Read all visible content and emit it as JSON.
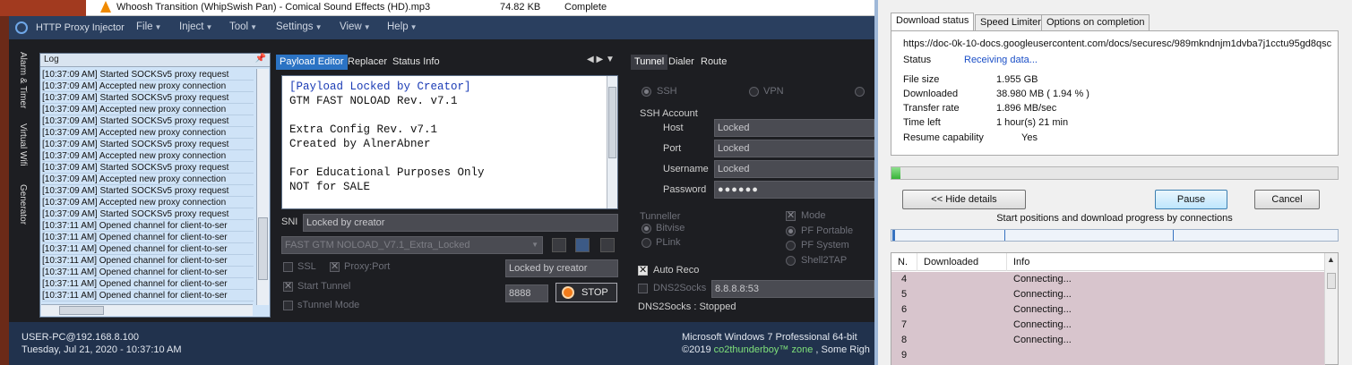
{
  "background_download": {
    "filename": "Whoosh Transition (WhipSwish Pan) - Comical Sound Effects (HD).mp3",
    "size": "74.82  KB",
    "status": "Complete"
  },
  "injector": {
    "title": "HTTP Proxy Injector",
    "menu": [
      "File",
      "Inject",
      "Tool",
      "Settings",
      "View",
      "Help"
    ],
    "side_tabs": [
      "Alarm & Timer",
      "Virtual Wifi",
      "Generator"
    ],
    "log": {
      "title": "Log",
      "lines": [
        "[10:37:09 AM] Started SOCKSv5 proxy request",
        "[10:37:09 AM] Accepted new proxy connection",
        "[10:37:09 AM] Started SOCKSv5 proxy request",
        "[10:37:09 AM] Accepted new proxy connection",
        "[10:37:09 AM] Started SOCKSv5 proxy request",
        "[10:37:09 AM] Accepted new proxy connection",
        "[10:37:09 AM] Started SOCKSv5 proxy request",
        "[10:37:09 AM] Accepted new proxy connection",
        "[10:37:09 AM] Started SOCKSv5 proxy request",
        "[10:37:09 AM] Accepted new proxy connection",
        "[10:37:09 AM] Started SOCKSv5 proxy request",
        "[10:37:09 AM] Accepted new proxy connection",
        "[10:37:09 AM] Started SOCKSv5 proxy request",
        "[10:37:11 AM] Opened channel for client-to-ser",
        "[10:37:11 AM] Opened channel for client-to-ser",
        "[10:37:11 AM] Opened channel for client-to-ser",
        "[10:37:11 AM] Opened channel for client-to-ser",
        "[10:37:11 AM] Opened channel for client-to-ser",
        "[10:37:11 AM] Opened channel for client-to-ser",
        "[10:37:11 AM] Opened channel for client-to-ser"
      ]
    },
    "center_tabs": [
      "Payload Editor",
      "Replacer",
      "Status Info"
    ],
    "payload": {
      "line1": "[Payload Locked by Creator]",
      "body": "\nGTM FAST NOLOAD Rev. v7.1\n\nExtra Config Rev. v7.1\nCreated by AlnerAbner\n\nFor Educational Purposes Only\nNOT for SALE"
    },
    "sni_label": "SNI",
    "sni_value": "Locked by creator",
    "config_select": "FAST GTM NOLOAD_V7.1_Extra_Locked",
    "ssl_label": "SSL",
    "proxy_port_label": "Proxy:Port",
    "proxy_value": "Locked by creator",
    "start_tunnel_label": "Start Tunnel",
    "stunnel_label": "sTunnel Mode",
    "port_value": "8888",
    "stop_label": "STOP",
    "right_tabs": [
      "Tunnel",
      "Dialer",
      "Route"
    ],
    "ssh_label": "SSH",
    "vpn_label": "VPN",
    "ssh_account_label": "SSH Account",
    "host_label": "Host",
    "host_value": "Locked",
    "port_label": "Port",
    "port_field_value": "Locked",
    "username_label": "Username",
    "username_value": "Locked",
    "password_label": "Password",
    "password_value": "●●●●●●",
    "tunneller_label": "Tunneller",
    "bitvise_label": "Bitvise",
    "plink_label": "PLink",
    "mode_label": "Mode",
    "pf_portable_label": "PF Portable",
    "pf_system_label": "PF System",
    "shell2tap_label": "Shell2TAP",
    "auto_reco_label": "Auto Reco",
    "dns2socks_label": "DNS2Socks",
    "dns_value": "8.8.8.8:53",
    "dns2socks_status": "DNS2Socks : Stopped",
    "status_user": "USER-PC@192.168.8.100",
    "status_datetime": "Tuesday, Jul 21, 2020 - 10:37:10 AM",
    "status_os": "Microsoft Windows 7 Professional  64-bit",
    "status_copyright_pre": "©2019 ",
    "status_copyright_brand": "co2thunderboy™ zone",
    "status_copyright_post": " , Some Righ"
  },
  "download_dialog": {
    "tabs": [
      "Download status",
      "Speed Limiter",
      "Options on completion"
    ],
    "url": "https://doc-0k-10-docs.googleusercontent.com/docs/securesc/989mkndnjm1dvba7j1cctu95gd8qsc",
    "status_label": "Status",
    "status_value": "Receiving data...",
    "file_size_label": "File size",
    "file_size_value": "1.955  GB",
    "downloaded_label": "Downloaded",
    "downloaded_value": "38.980  MB  ( 1.94 % )",
    "transfer_rate_label": "Transfer rate",
    "transfer_rate_value": "1.896  MB/sec",
    "time_left_label": "Time left",
    "time_left_value": "1 hour(s) 21 min",
    "resume_label": "Resume capability",
    "resume_value": "Yes",
    "progress_fraction": 0.0194,
    "hide_details_label": "<< Hide details",
    "pause_label": "Pause",
    "cancel_label": "Cancel",
    "connections_caption": "Start positions and download progress by connections",
    "table_headers": [
      "N.",
      "Downloaded",
      "Info"
    ],
    "rows": [
      {
        "n": "4",
        "info": "Connecting..."
      },
      {
        "n": "5",
        "info": "Connecting..."
      },
      {
        "n": "6",
        "info": "Connecting..."
      },
      {
        "n": "7",
        "info": "Connecting..."
      },
      {
        "n": "8",
        "info": "Connecting..."
      },
      {
        "n": "9",
        "info": ""
      }
    ]
  }
}
